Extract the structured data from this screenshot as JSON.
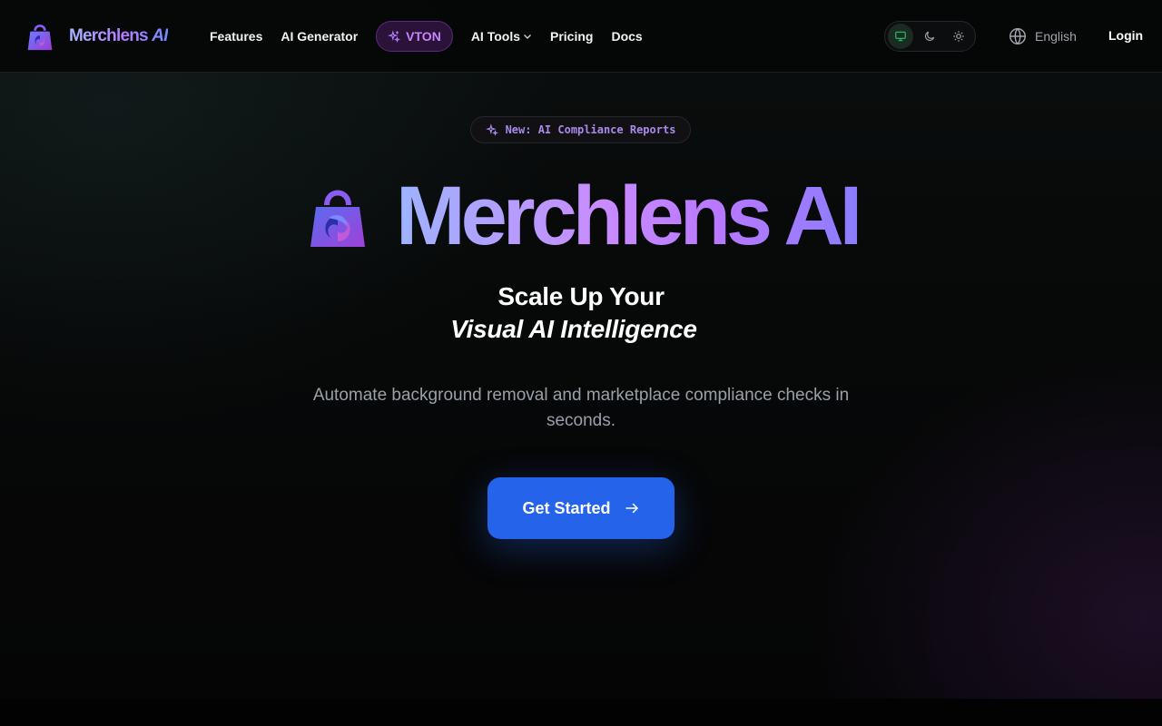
{
  "nav": {
    "brand_name": "Merchlens",
    "brand_suffix": "AI",
    "links": [
      "Features",
      "AI Generator"
    ],
    "vton_label": "VTON",
    "ai_tools_label": "AI Tools",
    "pricing_label": "Pricing",
    "docs_label": "Docs",
    "language": "English",
    "login_label": "Login"
  },
  "theme": {
    "options": [
      "system",
      "dark",
      "light"
    ],
    "active": "system",
    "active_color": "#22c55e"
  },
  "hero": {
    "badge_text": "New: AI Compliance Reports",
    "title": "Merchlens AI",
    "tagline_line1": "Scale Up Your",
    "tagline_line2": "Visual AI Intelligence",
    "description": "Automate background removal and marketplace compliance checks in seconds.",
    "cta_label": "Get Started"
  },
  "colors": {
    "accent_blue": "#2563eb",
    "accent_purple": "#c685ff",
    "brand_gradient_start": "#9db3ff",
    "brand_gradient_end": "#8b7dff"
  },
  "icons": {
    "brand": "shopping-bag-swirl-icon",
    "vton": "sparkles-icon",
    "badge": "sparkles-icon",
    "language": "globe-icon",
    "cta": "arrow-right-icon"
  }
}
